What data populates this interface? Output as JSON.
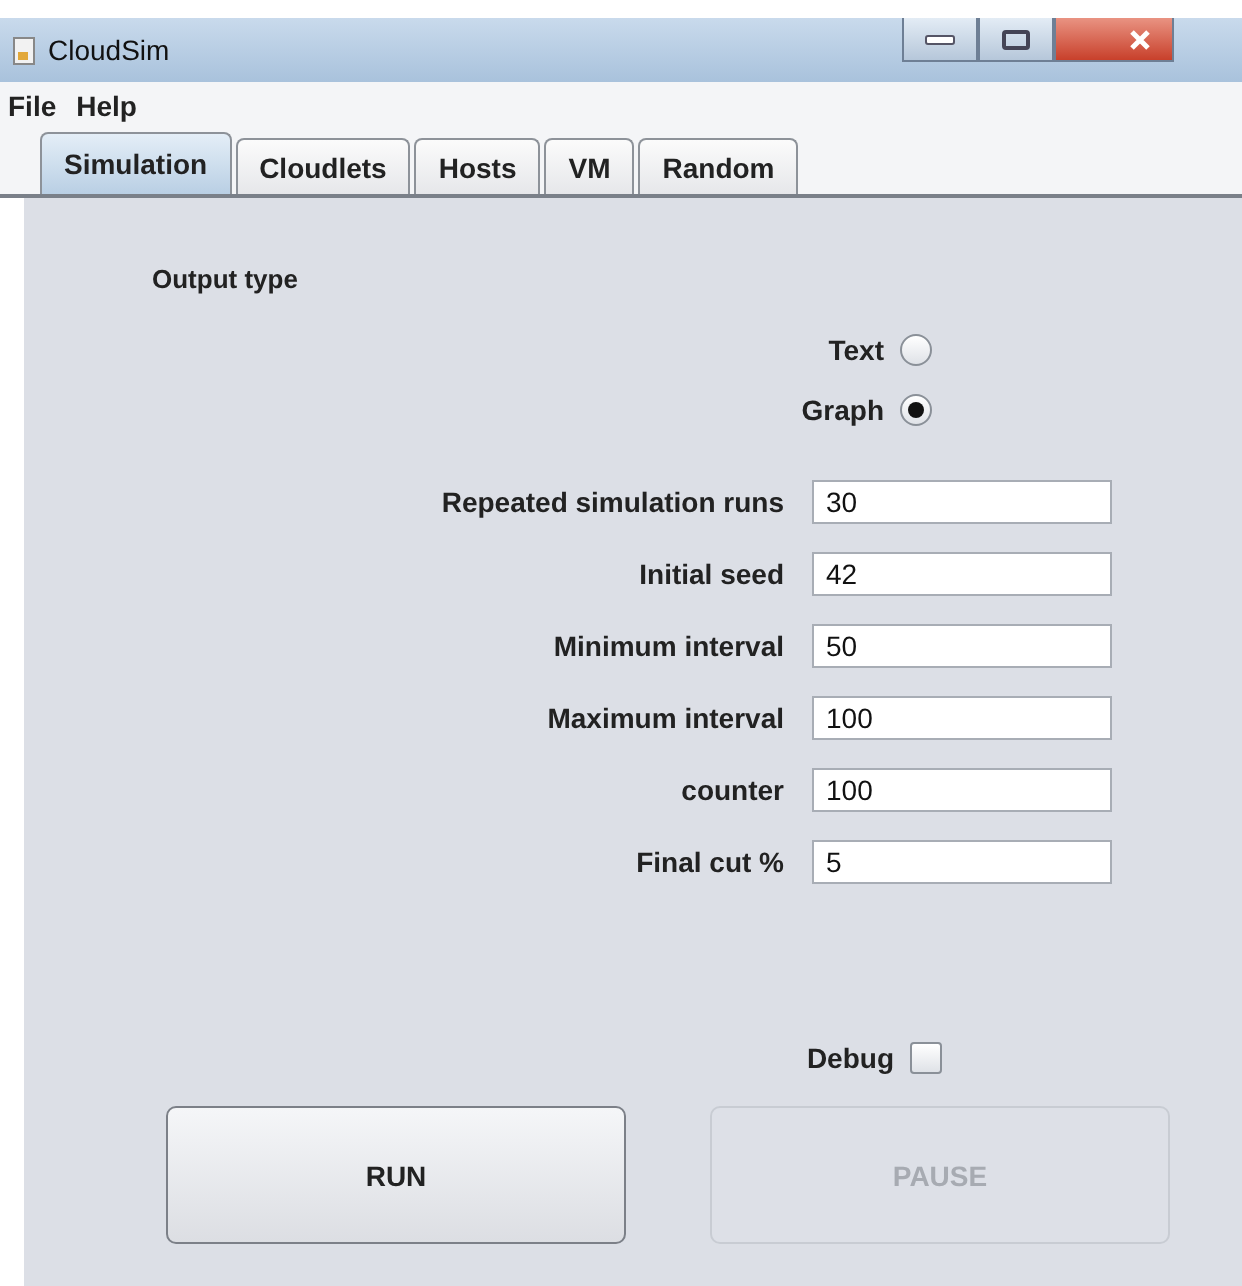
{
  "window": {
    "title": "CloudSim"
  },
  "menu": [
    "File",
    "Help"
  ],
  "tabs": [
    {
      "label": "Simulation",
      "selected": true
    },
    {
      "label": "Cloudlets",
      "selected": false
    },
    {
      "label": "Hosts",
      "selected": false
    },
    {
      "label": "VM",
      "selected": false
    },
    {
      "label": "Random",
      "selected": false
    }
  ],
  "output_type": {
    "label": "Output type",
    "options": [
      {
        "label": "Text",
        "selected": false
      },
      {
        "label": "Graph",
        "selected": true
      }
    ]
  },
  "fields": [
    {
      "label": "Repeated simulation runs",
      "value": "30"
    },
    {
      "label": "Initial seed",
      "value": "42"
    },
    {
      "label": "Minimum interval",
      "value": "50"
    },
    {
      "label": "Maximum interval",
      "value": "100"
    },
    {
      "label": "counter",
      "value": "100"
    },
    {
      "label": "Final cut %",
      "value": "5"
    }
  ],
  "debug": {
    "label": "Debug",
    "checked": false
  },
  "buttons": [
    {
      "label": "RUN",
      "disabled": false
    },
    {
      "label": "PAUSE",
      "disabled": true
    }
  ]
}
